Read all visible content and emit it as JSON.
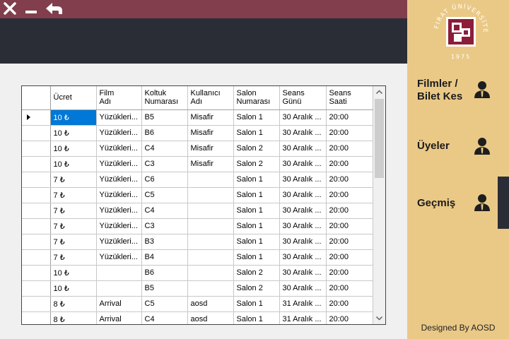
{
  "window": {
    "close_icon": "close-icon",
    "minimize_icon": "minimize-icon",
    "back_icon": "back-arrow-icon"
  },
  "sidebar": {
    "logo": {
      "ring_text": "FIRAT ÜNİVERSİTESİ",
      "year": "1975",
      "brand_color": "#8b1d3b"
    },
    "items": [
      {
        "label_line1": "Filmler /",
        "label_line2": "Bilet Kes",
        "icon": "user-icon"
      },
      {
        "label_line1": "Üyeler",
        "label_line2": "",
        "icon": "user-icon"
      },
      {
        "label_line1": "Geçmiş",
        "label_line2": "",
        "icon": "user-icon",
        "active": true
      }
    ],
    "footer": "Designed By AOSD"
  },
  "grid": {
    "columns": [
      {
        "line1": "Ücret",
        "line2": ""
      },
      {
        "line1": "Film",
        "line2": "Adı"
      },
      {
        "line1": "Koltuk",
        "line2": "Numarası"
      },
      {
        "line1": "Kullanıcı",
        "line2": "Adı"
      },
      {
        "line1": "Salon",
        "line2": "Numarası"
      },
      {
        "line1": "Seans",
        "line2": "Günü"
      },
      {
        "line1": "Seans",
        "line2": "Saati"
      }
    ],
    "rows": [
      [
        "10 ₺",
        "Yüzükleri...",
        "B5",
        "Misafir",
        "Salon 1",
        "30 Aralık ...",
        "20:00"
      ],
      [
        "10 ₺",
        "Yüzükleri...",
        "B6",
        "Misafir",
        "Salon 1",
        "30 Aralık ...",
        "20:00"
      ],
      [
        "10 ₺",
        "Yüzükleri...",
        "C4",
        "Misafir",
        "Salon 2",
        "30 Aralık ...",
        "20:00"
      ],
      [
        "10 ₺",
        "Yüzükleri...",
        "C3",
        "Misafir",
        "Salon 2",
        "30 Aralık ...",
        "20:00"
      ],
      [
        "7 ₺",
        "Yüzükleri...",
        "C6",
        "",
        "Salon 1",
        "30 Aralık ...",
        "20:00"
      ],
      [
        "7 ₺",
        "Yüzükleri...",
        "C5",
        "",
        "Salon 1",
        "30 Aralık ...",
        "20:00"
      ],
      [
        "7 ₺",
        "Yüzükleri...",
        "C4",
        "",
        "Salon 1",
        "30 Aralık ...",
        "20:00"
      ],
      [
        "7 ₺",
        "Yüzükleri...",
        "C3",
        "",
        "Salon 1",
        "30 Aralık ...",
        "20:00"
      ],
      [
        "7 ₺",
        "Yüzükleri...",
        "B3",
        "",
        "Salon 1",
        "30 Aralık ...",
        "20:00"
      ],
      [
        "7 ₺",
        "Yüzükleri...",
        "B4",
        "",
        "Salon 1",
        "30 Aralık ...",
        "20:00"
      ],
      [
        "10 ₺",
        "",
        "B6",
        "",
        "Salon 2",
        "30 Aralık ...",
        "20:00"
      ],
      [
        "10 ₺",
        "",
        "B5",
        "",
        "Salon 2",
        "30 Aralık ...",
        "20:00"
      ],
      [
        "8 ₺",
        "Arrival",
        "C5",
        "aosd",
        "Salon 1",
        "31 Aralık ...",
        "20:00"
      ],
      [
        "8 ₺",
        "Arrival",
        "C4",
        "aosd",
        "Salon 1",
        "31 Aralık ...",
        "20:00"
      ]
    ],
    "selected_row": 0
  },
  "colors": {
    "titlebar": "#823e4c",
    "darkbar": "#2b2d36",
    "sidebar": "#eac987",
    "selection": "#0078d7"
  }
}
